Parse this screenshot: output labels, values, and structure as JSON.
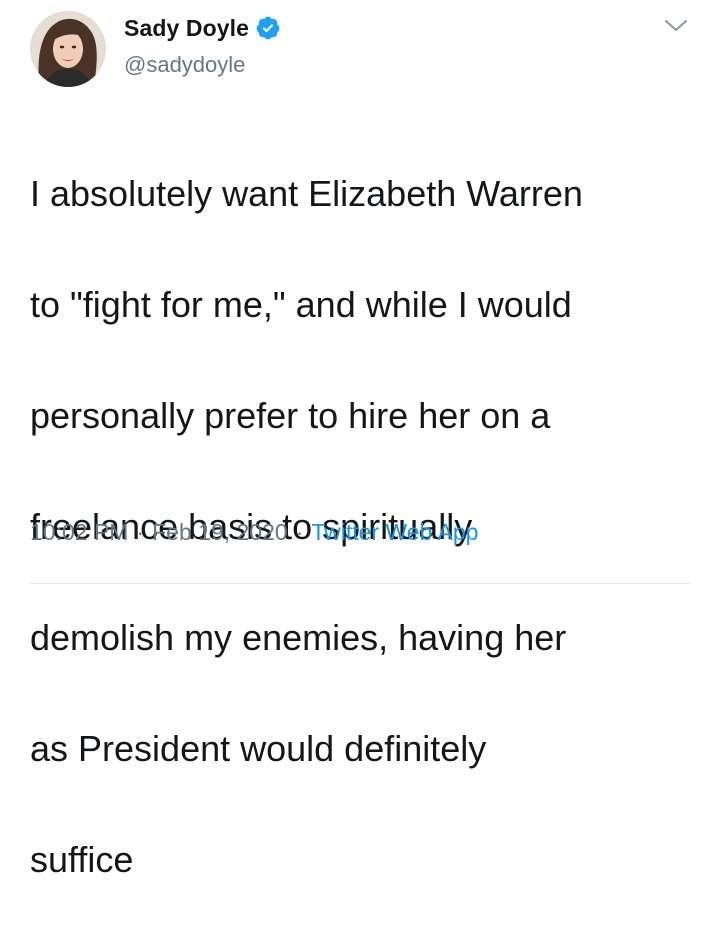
{
  "author": {
    "display_name": "Sady Doyle",
    "handle": "@sadydoyle",
    "verified": true,
    "avatar_icon": "profile-photo"
  },
  "tweet": {
    "text_lines": [
      "I absolutely want Elizabeth Warren",
      "to \"fight for me,\" and while I would",
      "personally prefer to hire her on a",
      "freelance basis to spiritually",
      "demolish my enemies, having her",
      "as President would definitely",
      "suffice"
    ]
  },
  "meta": {
    "time": "10:02 PM",
    "separator": "·",
    "date": "Feb 19, 2020",
    "source": "Twitter Web App"
  },
  "colors": {
    "verified_blue": "#1da1f2",
    "link_blue": "#1b95e0",
    "muted_gray": "#657786",
    "text_dark": "#14171a"
  },
  "icons": {
    "menu": "chevron-down-icon",
    "verified": "verified-badge-icon"
  }
}
